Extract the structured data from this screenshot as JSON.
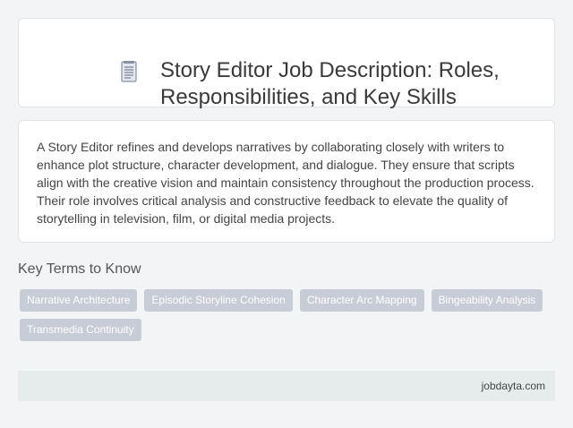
{
  "header": {
    "icon": "document-icon",
    "title": "Story Editor Job Description: Roles, Responsibilities, and Key Skills"
  },
  "description": {
    "text": "A Story Editor refines and develops narratives by collaborating closely with writers to enhance plot structure, character development, and dialogue. They ensure that scripts align with the creative vision and maintain consistency throughout the production process. Their role involves critical analysis and constructive feedback to elevate the quality of storytelling in television, film, or digital media projects."
  },
  "key_terms": {
    "heading": "Key Terms to Know",
    "tags": [
      "Narrative Architecture",
      "Episodic Storyline Cohesion",
      "Character Arc Mapping",
      "Bingeability Analysis",
      "Transmedia Continuity"
    ]
  },
  "footer": {
    "site": "jobdayta.com"
  },
  "colors": {
    "background": "#f2f4f5",
    "card": "#ffffff",
    "tag_bg": "#c8ccd6",
    "footer_bg": "#e6ecec"
  }
}
